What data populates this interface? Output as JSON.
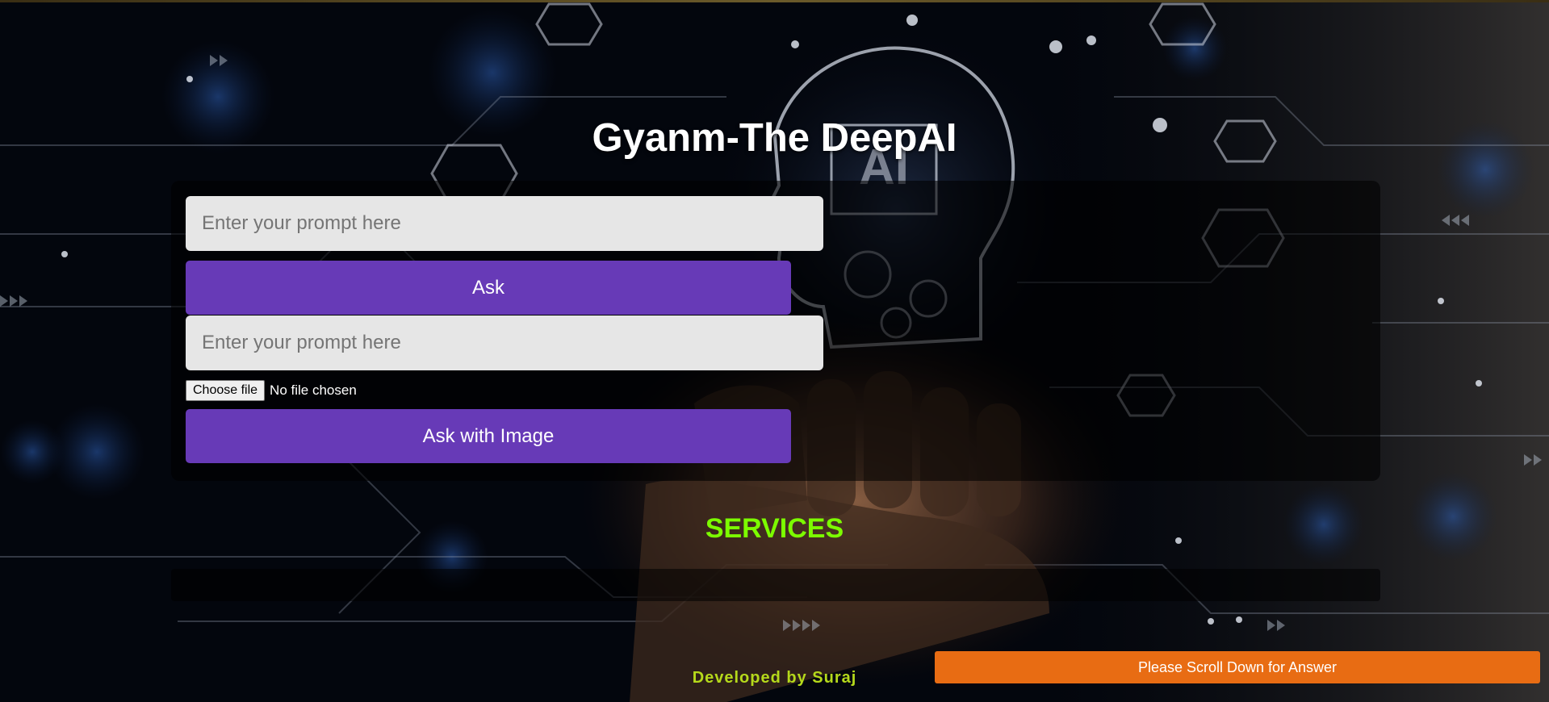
{
  "header": {
    "title": "Gyanm-The DeepAI"
  },
  "form": {
    "prompt_placeholder": "Enter your prompt here",
    "ask_label": "Ask",
    "image_prompt_placeholder": "Enter your prompt here",
    "choose_file_label": "Choose file",
    "file_status": "No file chosen",
    "ask_with_image_label": "Ask with Image"
  },
  "services": {
    "title": "SERVICES"
  },
  "footer": {
    "credit": "Developed by Suraj",
    "scroll_hint_label": "Please Scroll Down for Answer"
  },
  "colors": {
    "button_purple": "#673ab7",
    "services_green": "#7cfc00",
    "credit_yellow": "#b5d91b",
    "scroll_orange": "#e86c13"
  },
  "background": {
    "subject": "ai-head-circuit-hand-illustration",
    "printed_marks": [
      "AI"
    ]
  }
}
